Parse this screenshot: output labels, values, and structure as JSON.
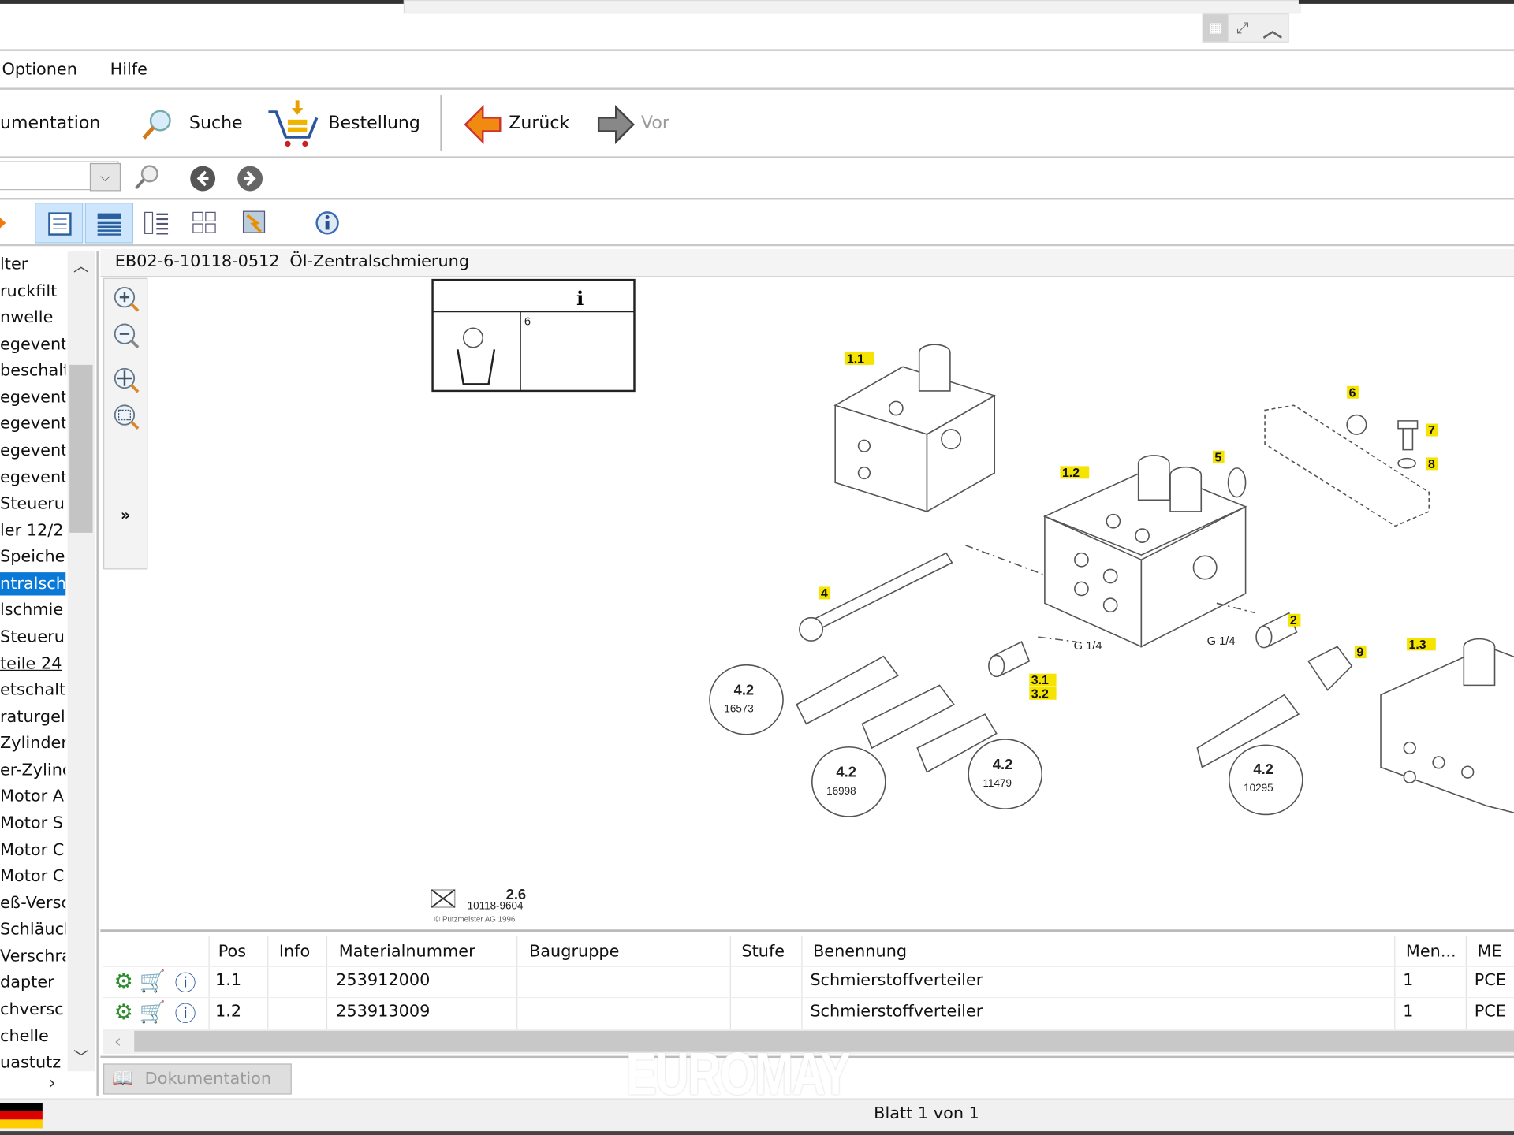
{
  "window": {
    "top_icons": [
      "grid-icon",
      "fullscreen-icon",
      "chevron-up-icon"
    ]
  },
  "menu": {
    "items": [
      {
        "label": "Optionen"
      },
      {
        "label": "Hilfe"
      }
    ]
  },
  "toolbar": {
    "dokumentation_label": "umentation",
    "suche_label": "Suche",
    "bestellung_label": "Bestellung",
    "zurueck_label": "Zurück",
    "vor_label": "Vor"
  },
  "search": {
    "value": "",
    "placeholder": ""
  },
  "sidebar": {
    "items": [
      "lter",
      "ruckfilt",
      "nwelle",
      "egevent",
      "beschalt",
      "egevent",
      "egevent",
      "egevent",
      "egevent",
      "Steueru",
      "ler 12/2",
      "Speiche",
      "ntralschr",
      "lschmie",
      "Steueru",
      "teile 24",
      "etschalt",
      "raturgel",
      "Zylinder",
      "er-Zylinc",
      "Motor A",
      "Motor S",
      "Motor C",
      "Motor C",
      "eß-Versc",
      "Schläucl",
      "Verschra",
      "dapter",
      "chversc",
      "chelle",
      "uastutz"
    ],
    "selected_index": 12,
    "hover_index": 15
  },
  "document": {
    "code": "EB02-6-10118-0512",
    "title": "Öl-Zentralschmierung"
  },
  "diagram": {
    "info_box_number": "6",
    "callouts": [
      "1.1",
      "1.2",
      "1.3",
      "2",
      "3.1",
      "3.2",
      "4",
      "5",
      "6",
      "7",
      "8",
      "9"
    ],
    "thread_labels": [
      "G 1/4",
      "G 1/4"
    ],
    "references": [
      {
        "section": "4.2",
        "number": "16573"
      },
      {
        "section": "4.2",
        "number": "16998"
      },
      {
        "section": "4.2",
        "number": "11479"
      },
      {
        "section": "4.2",
        "number": "10295"
      }
    ],
    "footer_section": "2.6",
    "footer_drawing": "10118-9604",
    "footer_copyright": "© Putzmeister AG 1996"
  },
  "table": {
    "columns": [
      "Pos",
      "Info",
      "Materialnummer",
      "Baugruppe",
      "Stufe",
      "Benennung",
      "Men...",
      "ME"
    ],
    "rows": [
      {
        "pos": "1.1",
        "info": "",
        "material": "253912000",
        "baugruppe": "",
        "stufe": "",
        "benennung": "Schmierstoffverteiler",
        "menge": "1",
        "me": "PCE"
      },
      {
        "pos": "1.2",
        "info": "",
        "material": "253913009",
        "baugruppe": "",
        "stufe": "",
        "benennung": "Schmierstoffverteiler",
        "menge": "1",
        "me": "PCE"
      }
    ]
  },
  "bottom_tab": {
    "label": "Dokumentation"
  },
  "status": {
    "page": "Blatt 1 von 1",
    "language_flag": "de"
  },
  "watermark": "EUROMAY",
  "colors": {
    "selection": "#0a78d7",
    "callout_highlight": "#f5e400",
    "toggle_active": "#cde6fb"
  }
}
